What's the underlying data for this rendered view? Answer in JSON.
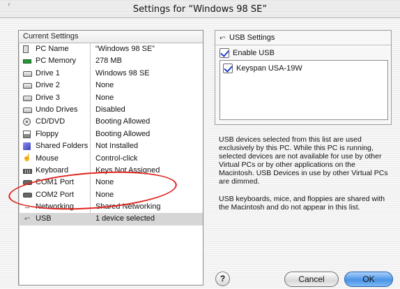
{
  "window": {
    "title": "Settings for “Windows 98 SE”",
    "corner_mark": "r"
  },
  "current_settings": {
    "header": "Current Settings",
    "rows": [
      {
        "icon": "pc-icon",
        "name": "PC Name",
        "value": "“Windows 98 SE”"
      },
      {
        "icon": "memory-icon",
        "name": "PC Memory",
        "value": "278 MB"
      },
      {
        "icon": "drive-icon",
        "name": "Drive 1",
        "value": "Windows 98 SE"
      },
      {
        "icon": "drive-icon",
        "name": "Drive 2",
        "value": "None"
      },
      {
        "icon": "drive-icon",
        "name": "Drive 3",
        "value": "None"
      },
      {
        "icon": "undo-drive-icon",
        "name": "Undo Drives",
        "value": "Disabled"
      },
      {
        "icon": "cd-icon",
        "name": "CD/DVD",
        "value": "Booting Allowed"
      },
      {
        "icon": "floppy-icon",
        "name": "Floppy",
        "value": "Booting Allowed"
      },
      {
        "icon": "shared-folder-icon",
        "name": "Shared Folders",
        "value": "Not Installed"
      },
      {
        "icon": "mouse-icon",
        "name": "Mouse",
        "value": "Control-click"
      },
      {
        "icon": "keyboard-icon",
        "name": "Keyboard",
        "value": "Keys Not Assigned"
      },
      {
        "icon": "serial-port-icon",
        "name": "COM1 Port",
        "value": "None"
      },
      {
        "icon": "serial-port-icon",
        "name": "COM2 Port",
        "value": "None"
      },
      {
        "icon": "networking-icon",
        "name": "Networking",
        "value": "Shared Networking"
      },
      {
        "icon": "usb-icon",
        "name": "USB",
        "value": "1 device selected"
      }
    ]
  },
  "usb_settings": {
    "header": "USB Settings",
    "enable_label": "Enable USB",
    "enable_checked": true,
    "devices": [
      {
        "label": "Keyspan USA-19W",
        "checked": true
      }
    ]
  },
  "description": {
    "p1": "USB devices selected from this list are used exclusively by this PC. While this PC is running, selected devices are not available for use by other Virtual PCs or by other applications on the Macintosh. USB Devices in use by other Virtual PCs are dimmed.",
    "p2": "USB keyboards, mice, and floppies are shared with the Macintosh and do not appear in this list."
  },
  "buttons": {
    "help": "?",
    "cancel": "Cancel",
    "ok": "OK"
  },
  "colors": {
    "annotation": "#e0221c",
    "ok_button": "#4b93e6",
    "check_mark": "#1f44c8"
  }
}
